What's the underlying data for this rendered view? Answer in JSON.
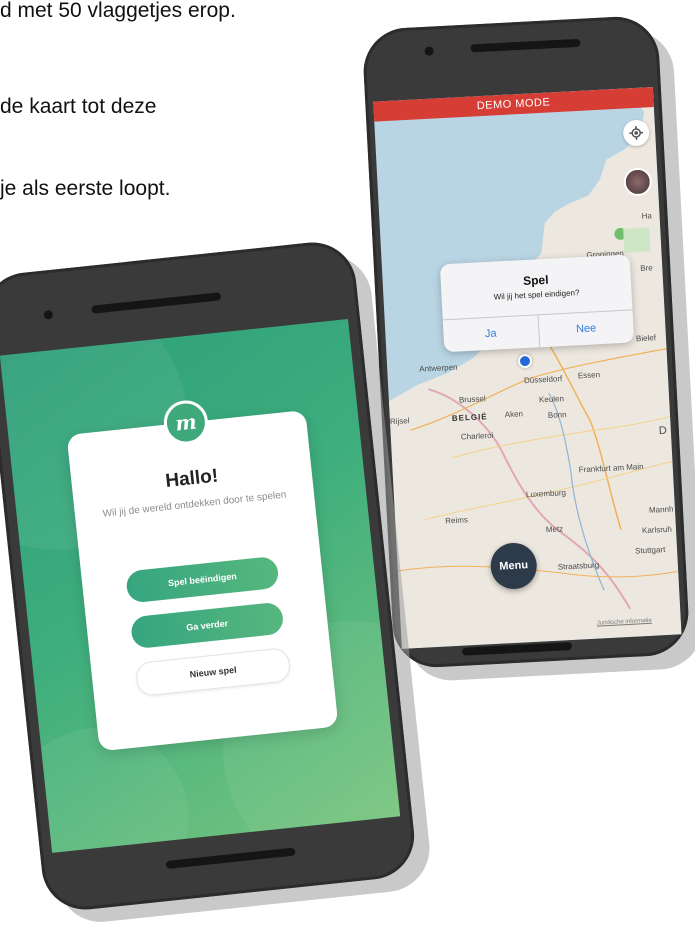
{
  "document": {
    "lines": [
      "d met 50 vlaggetjes erop.",
      "de kaart tot deze",
      "je als eerste loopt."
    ]
  },
  "map_phone": {
    "banner": "DEMO MODE",
    "dialog": {
      "title": "Spel",
      "message": "Wil jij het spel eindigen?",
      "yes": "Ja",
      "no": "Nee"
    },
    "menu_button": "Menu",
    "cities": {
      "groningen": "Groningen",
      "antwerpen": "Antwerpen",
      "dusseldorf": "Düsseldorf",
      "essen": "Essen",
      "brussel": "Brussel",
      "keulen": "Keulen",
      "rijsel": "Rijsel",
      "belgie": "BELGIË",
      "aken": "Aken",
      "bonn": "Bonn",
      "charleroi": "Charleroi",
      "frankfurt": "Frankfurt am Main",
      "luxemburg": "Luxemburg",
      "reims": "Reims",
      "metz": "Metz",
      "karlsruhe": "Karlsruh",
      "mannheim": "Mannh",
      "stuttgart": "Stuttgart",
      "straatsburg": "Straatsburg",
      "bielefeld": "Bielef",
      "ha": "Ha",
      "bre": "Bre",
      "d": "D"
    },
    "map_credit": "Juridische informatie",
    "accent_color": "#d63d35"
  },
  "green_phone": {
    "logo_letter": "m",
    "title": "Hallo!",
    "subtitle": "Wil jij de wereld ontdekken door te spelen",
    "buttons": {
      "end_game": "Spel beëindigen",
      "continue": "Ga verder",
      "new_game": "Nieuw spel"
    },
    "accent_color": "#3fa97b"
  }
}
